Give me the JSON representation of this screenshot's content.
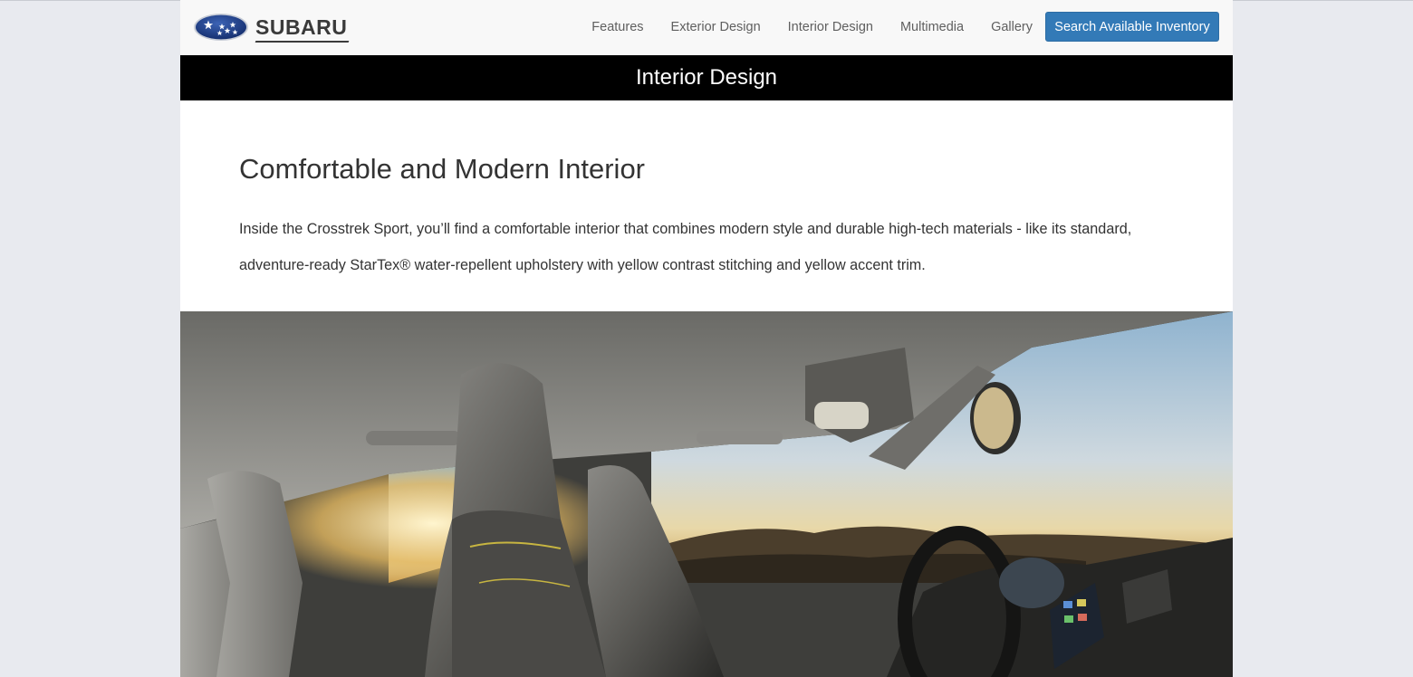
{
  "brand": {
    "name": "SUBARU",
    "emblem_color": "#1f3f8b"
  },
  "nav": {
    "links": [
      "Features",
      "Exterior Design",
      "Interior Design",
      "Multimedia",
      "Gallery"
    ],
    "cta_label": "Search Available Inventory",
    "cta_color": "#337ab7"
  },
  "section": {
    "title": "Interior Design"
  },
  "content": {
    "headline": "Comfortable and Modern Interior",
    "body": "Inside the Crosstrek Sport, you’ll find a comfortable interior that combines modern style and durable high-tech materials - like its standard, adventure-ready StarTex® water-repellent upholstery with yellow contrast stitching and yellow accent trim."
  },
  "hero": {
    "image": "car-interior-photo"
  }
}
